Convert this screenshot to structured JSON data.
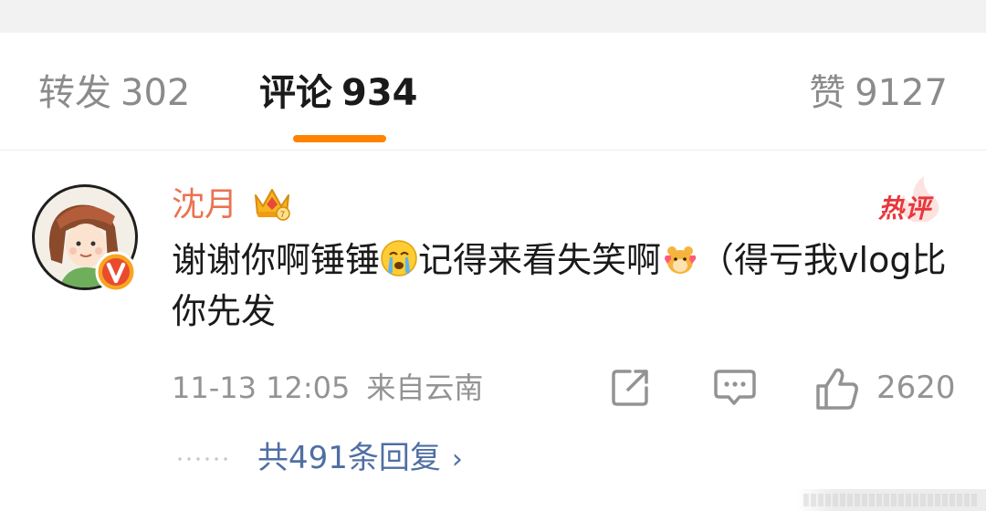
{
  "tabs": [
    {
      "label": "转发",
      "count": "302",
      "active": false
    },
    {
      "label": "评论",
      "count": "934",
      "active": true
    },
    {
      "label": "赞",
      "count": "9127",
      "active": false
    }
  ],
  "comment": {
    "username": "沈月",
    "hot_label": "热评",
    "text_part1": "谢谢你啊锤锤",
    "text_part2": "记得来看失笑啊",
    "text_part3": "（得亏我vlog比你先发",
    "time": "11-13 12:05",
    "location": "来自云南",
    "like_count": "2620",
    "replies_label": "共491条回复",
    "icons": [
      "crown-badge",
      "verified-v-badge",
      "crying-emoji",
      "hamster-heart-emoji",
      "share-icon",
      "comment-icon",
      "thumbs-up-icon",
      "chevron-right-icon"
    ]
  },
  "colors": {
    "accent": "#ff8200",
    "username": "#eb7350",
    "hot": "#e8373c",
    "link": "#4f6fa3",
    "muted": "#939393"
  }
}
